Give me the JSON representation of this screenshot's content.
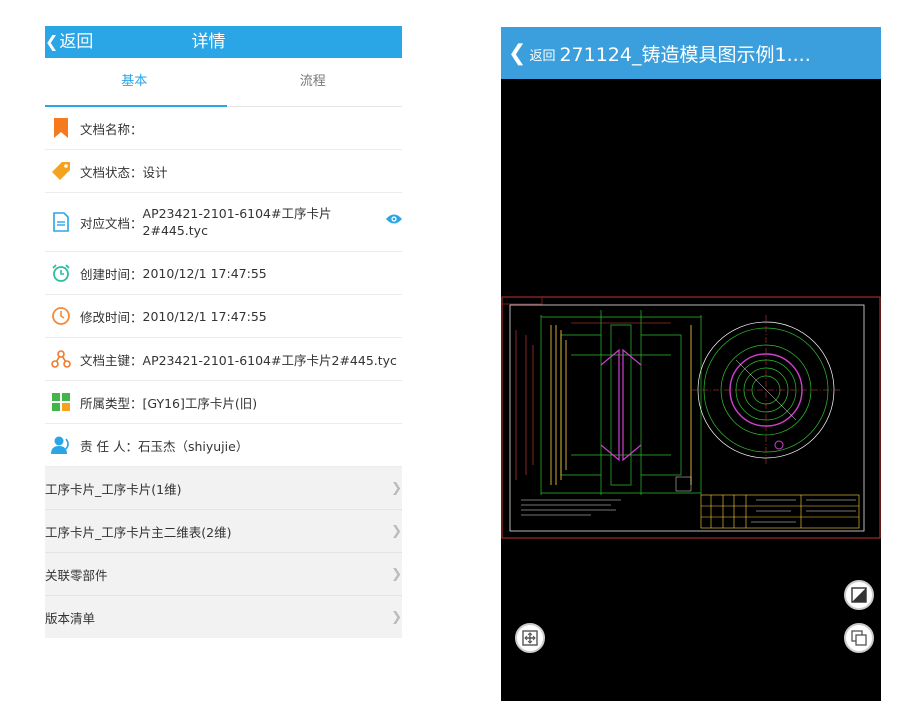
{
  "left": {
    "header": {
      "back_label": "返回",
      "title": "详情"
    },
    "tabs": [
      {
        "label": "基本"
      },
      {
        "label": "流程"
      }
    ],
    "fields": [
      {
        "icon": "bookmark-icon",
        "label": "文档名称：",
        "value": ""
      },
      {
        "icon": "tag-icon",
        "label": "文档状态：",
        "value": "设计"
      },
      {
        "icon": "document-icon",
        "label": "对应文档：",
        "value": "AP23421-2101-6104#工序卡片2#445.tyc"
      },
      {
        "icon": "alarm-clock-icon",
        "label": "创建时间：",
        "value": "2010/12/1 17:47:55"
      },
      {
        "icon": "clock-icon",
        "label": "修改时间：",
        "value": "2010/12/1 17:47:55"
      },
      {
        "icon": "share-nodes-icon",
        "label": "文档主键：",
        "value": "AP23421-2101-6104#工序卡片2#445.tyc"
      },
      {
        "icon": "grid-icon",
        "label": "所属类型：",
        "value": "[GY16]工序卡片(旧)"
      },
      {
        "icon": "person-icon",
        "label": "责 任 人：",
        "value": "石玉杰（shiyujie）"
      }
    ],
    "sections": [
      {
        "label": "工序卡片_工序卡片(1维)"
      },
      {
        "label": "工序卡片_工序卡片主二维表(2维)"
      },
      {
        "label": "关联零部件"
      },
      {
        "label": "版本清单"
      }
    ],
    "colors": {
      "accent": "#2aa5e6"
    }
  },
  "right": {
    "header": {
      "back_label": "返回",
      "title": "271124_铸造模具图示例1...."
    },
    "colors": {
      "header": "#3a9fdc",
      "background": "#000000"
    }
  }
}
